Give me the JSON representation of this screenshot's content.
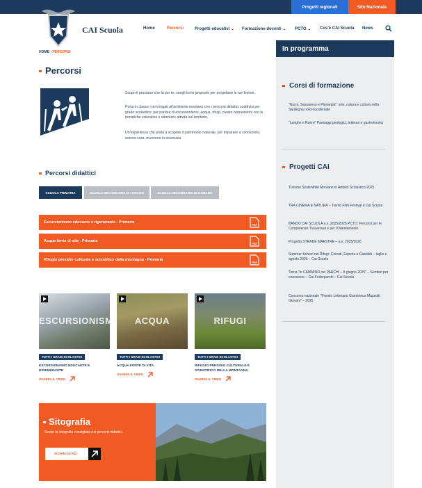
{
  "topbar": {
    "projects_regional": "Progetti regionali",
    "national_site": "Sito Nazionale"
  },
  "brand": {
    "name": "CAI Scuola"
  },
  "nav": {
    "items": [
      "Home",
      "Percorsi",
      "Progetti educativi ⌄",
      "Formazione docenti ⌄",
      "PCTO ⌄",
      "Cos'è CAI Scuola",
      "News"
    ],
    "active_index": 1
  },
  "breadcrumb": {
    "home": "HOME",
    "sep": " › ",
    "current": "PERCORSI"
  },
  "page_title": "Percorsi",
  "intro": {
    "p1": "Scopri il percorso che fa per te: scegli tra le proposte per progettare le tue lezioni.",
    "p2": "Porta in classe i temi legati all'ambiente montano con i percorsi didattici suddivisi per grado scolastico: per parlare di escursionismo, acqua, rifugi, creare connessioni con le tematiche educative e stimolare attività sul territorio.",
    "p3": "Un'esperienza che porta a scoprire il patrimonio naturale, per imparare a conoscerlo, averne cura, muoversi in sicurezza."
  },
  "didactic": {
    "title": "Percorsi didattici",
    "tabs": [
      "SCUOLA PRIMARIA",
      "SCUOLA SECONDARIA DI I GRADO",
      "SCUOLA SECONDARIA DI II GRADO"
    ],
    "active_tab": 0,
    "courses": [
      "Escursionismo educante e rigenerante - Primaria",
      "Acqua fonte di vita - Primaria",
      "Rifugio presidio culturale e scientifico della montagna - Primaria"
    ]
  },
  "videos": [
    {
      "overlay": "ESCURSIONISMO",
      "badge": "TUTTI I GRADI SCOLASTICI",
      "title": "ESCURSIONISMO EDUCANTE E RIGENERANTE",
      "link": "GUARDA IL VIDEO"
    },
    {
      "overlay": "ACQUA",
      "badge": "TUTTI I GRADI SCOLASTICI",
      "title": "ACQUA FONTE DI VITA",
      "link": "GUARDA IL VIDEO"
    },
    {
      "overlay": "RIFUGI",
      "badge": "TUTTI I GRADI SCOLASTICI",
      "title": "RIFUGIO PRESIDIO CULTURALE E SCIENTIFICO DELLA MONTAGNA",
      "link": "GUARDA IL VIDEO"
    }
  ],
  "sitografia": {
    "title": "Sitografia",
    "subtitle": "Scopri la sitografia consigliata nei percorsi didattici.",
    "button": "SCOPRI DI PIÙ"
  },
  "sidebar": {
    "heading": "In programma",
    "courses_title": "Corsi di formazione",
    "courses": [
      "\"Nurra, Sassareso e Planargia\": arte, natura e cultura nella Sardegna nord-occidentale",
      "\"Langhe e Roero\" Paesaggi geologici, letterari e gastronomici"
    ],
    "projects_title": "Progetti CAI",
    "projects": [
      "Turismo Sostenibile Montano in Ambito Scolastico 2025",
      "TRA CINEMA E NATURA – Trento Film Festival e Cai Scuola",
      "BANDO CAI SCUOLA a.s. 2025/2026 PCTO: Percorsi per le Competenze Trasversali e per l'Orientamento",
      "Progetto STRADE MAESTRE – a.s. 2025/2026",
      "Summer School nei Rifugi: Corvati, Esperia e Gastaldi – luglio e agosto 2025 – Cai Scuola",
      "Torna \"in CAMMINO nei PARCHI – 8 giugno 2025\" – Sentieri per conoscere – Cai-Federparchi – Cai Scuola",
      "Concorso nazionale \"Premio Letterario Gambrinus Mazzotti Giovani\" – 2025"
    ]
  },
  "colors": {
    "navy": "#1b3a5c",
    "orange": "#f15a22",
    "blue": "#2a6fd6",
    "sidebar_bg": "#edeef0"
  }
}
